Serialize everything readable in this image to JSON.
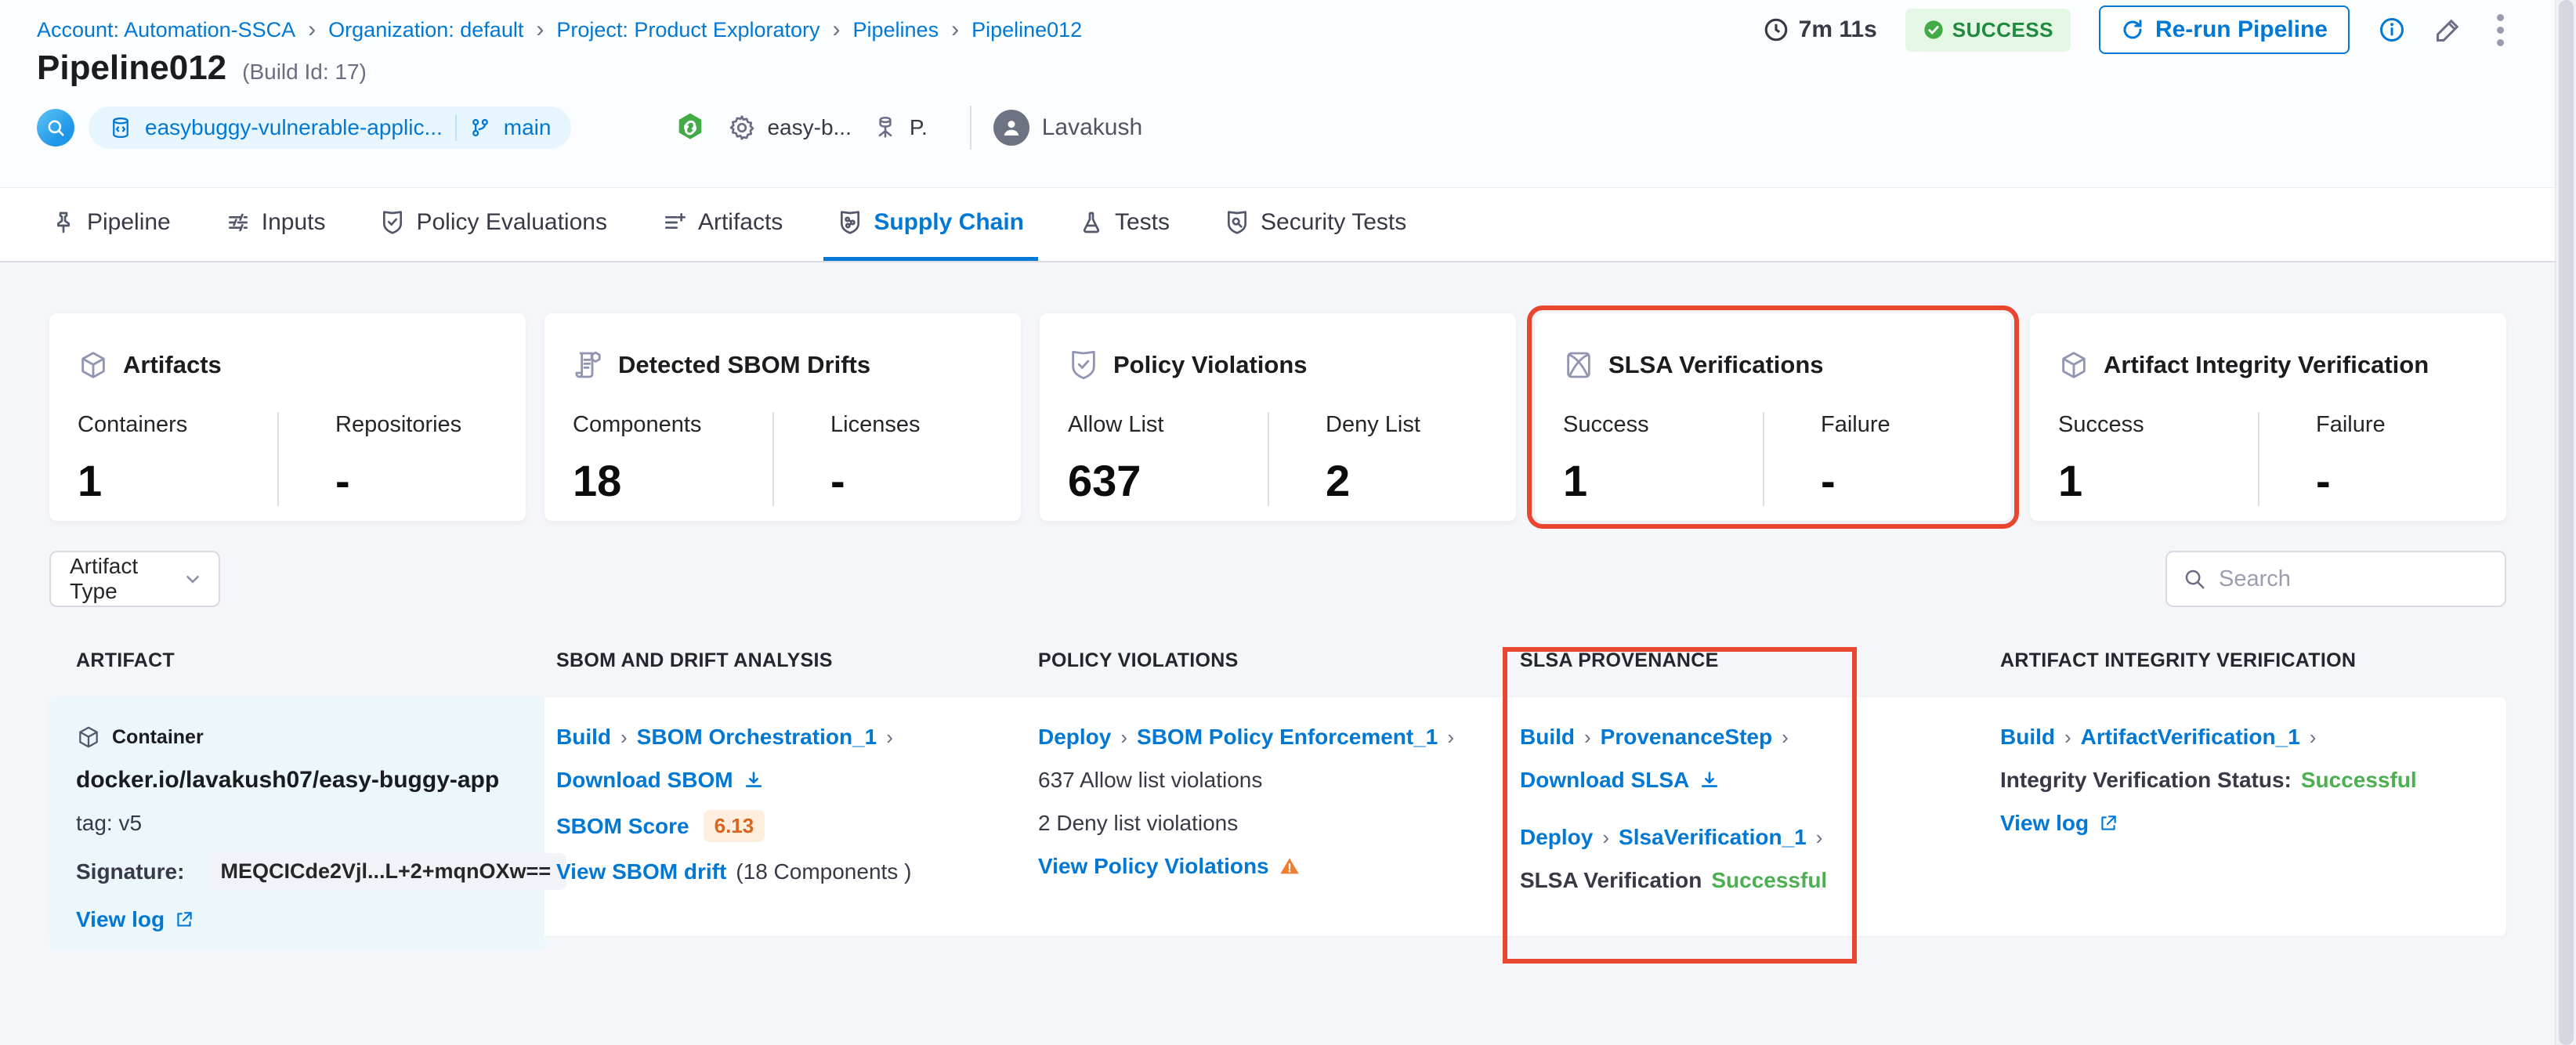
{
  "icons": {
    "breadcrumb_separator": "›",
    "step_chevron": "›"
  },
  "breadcrumb": [
    "Account: Automation-SSCA",
    "Organization: default",
    "Project: Product Exploratory",
    "Pipelines",
    "Pipeline012"
  ],
  "header": {
    "title": "Pipeline012",
    "build_id": "(Build Id: 17)",
    "duration": "7m 11s",
    "status": "SUCCESS",
    "rerun_label": "Re-run Pipeline",
    "repo_name": "easybuggy-vulnerable-applic...",
    "branch": "main",
    "trigger_name": "easy-b...",
    "trigger_abbrev": "P.",
    "user_name": "Lavakush"
  },
  "tabs": [
    {
      "label": "Pipeline"
    },
    {
      "label": "Inputs"
    },
    {
      "label": "Policy Evaluations"
    },
    {
      "label": "Artifacts"
    },
    {
      "label": "Supply Chain"
    },
    {
      "label": "Tests"
    },
    {
      "label": "Security Tests"
    }
  ],
  "active_tab": "Supply Chain",
  "colors": {
    "accent": "#0278d5",
    "highlight_red": "#e8462e",
    "success_green": "#4caf50",
    "warning_orange": "#e57a2b",
    "score_orange": "#d9641c"
  },
  "summary_cards": [
    {
      "title": "Artifacts",
      "stats": [
        {
          "label": "Containers",
          "value": "1"
        },
        {
          "label": "Repositories",
          "value": "-"
        }
      ]
    },
    {
      "title": "Detected SBOM Drifts",
      "stats": [
        {
          "label": "Components",
          "value": "18"
        },
        {
          "label": "Licenses",
          "value": "-"
        }
      ]
    },
    {
      "title": "Policy Violations",
      "stats": [
        {
          "label": "Allow List",
          "value": "637"
        },
        {
          "label": "Deny List",
          "value": "2"
        }
      ]
    },
    {
      "title": "SLSA Verifications",
      "highlighted": true,
      "stats": [
        {
          "label": "Success",
          "value": "1"
        },
        {
          "label": "Failure",
          "value": "-"
        }
      ]
    },
    {
      "title": "Artifact Integrity Verification",
      "stats": [
        {
          "label": "Success",
          "value": "1"
        },
        {
          "label": "Failure",
          "value": "-"
        }
      ]
    }
  ],
  "filters": {
    "artifact_type": "Artifact Type",
    "search_placeholder": "Search"
  },
  "table": {
    "columns": [
      "ARTIFACT",
      "SBOM AND DRIFT ANALYSIS",
      "POLICY VIOLATIONS",
      "SLSA PROVENANCE",
      "ARTIFACT INTEGRITY VERIFICATION"
    ],
    "row": {
      "artifact": {
        "type_label": "Container",
        "image": "docker.io/lavakush07/easy-buggy-app",
        "tag": "tag: v5",
        "signature_label": "Signature:",
        "signature_value": "MEQCICde2Vjl...L+2+mqnOXw==",
        "view_log": "View log"
      },
      "sbom": {
        "stage": "Build",
        "step": "SBOM Orchestration_1",
        "download": "Download SBOM",
        "score_label": "SBOM Score",
        "score_value": "6.13",
        "drift_link": "View SBOM drift",
        "drift_count": "(18 Components )"
      },
      "policy": {
        "stage": "Deploy",
        "step": "SBOM Policy Enforcement_1",
        "allow_violations": "637 Allow list violations",
        "deny_violations": "2 Deny list violations",
        "view_link": "View Policy Violations"
      },
      "slsa": {
        "stage_1": "Build",
        "step_1": "ProvenanceStep",
        "download": "Download SLSA",
        "stage_2": "Deploy",
        "step_2": "SlsaVerification_1",
        "status_label": "SLSA Verification",
        "status_value": "Successful"
      },
      "integrity": {
        "stage": "Build",
        "step": "ArtifactVerification_1",
        "status_label": "Integrity Verification Status:",
        "status_value": "Successful",
        "view_log": "View log"
      }
    }
  }
}
